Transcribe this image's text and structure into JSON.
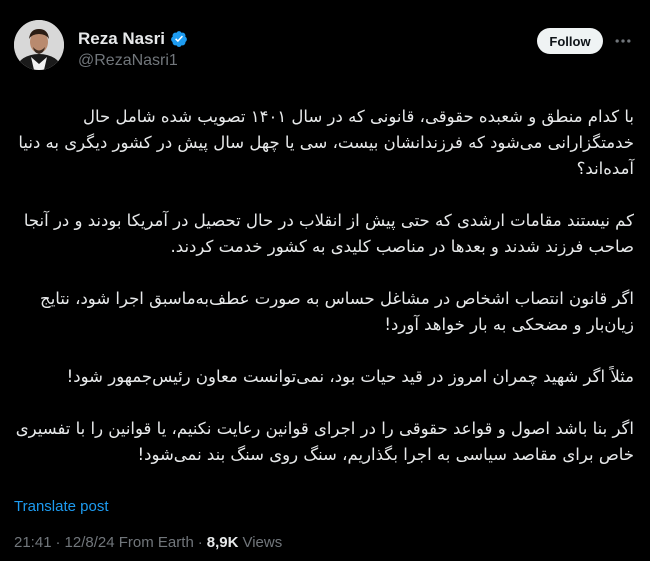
{
  "author": {
    "display_name": "Reza Nasri",
    "handle": "@RezaNasri1",
    "verified": true,
    "verified_color": "#1d9bf0"
  },
  "actions": {
    "follow_label": "Follow",
    "more_icon": "more-horizontal-icon"
  },
  "tweet": {
    "paragraphs": [
      "با کدام منطق و شعبده حقوقی، قانونی که در سال ۱۴۰۱ تصویب شده شامل حال خدمتگزارانی می‌شود که فرزندانشان بیست، سی یا چهل سال پیش در کشور دیگری به دنیا آمده‌اند؟",
      "کم نیستند مقامات ارشدی که حتی پیش از انقلاب در حال تحصیل در آمریکا بودند و در آنجا صاحب فرزند شدند و بعدها در مناصب کلیدی به کشور خدمت کردند.",
      "اگر قانون انتصاب اشخاص در مشاغل حساس به صورت عطف‌به‌ماسبق اجرا شود، نتایج زیان‌بار و مضحکی به بار خواهد آورد!",
      "مثلاً اگر شهید چمران امروز در قید حیات بود، نمی‌توانست معاون رئیس‌جمهور شود!",
      "اگر بنا باشد اصول و قواعد حقوقی را در اجرای قوانین رعایت نکنیم، یا قوانین را با تفسیری خاص برای مقاصد سیاسی به اجرا بگذاریم، سنگ روی سنگ بند نمی‌شود!"
    ],
    "translate_label": "Translate post"
  },
  "meta": {
    "time": "21:41",
    "date": "12/8/24",
    "source": "From Earth",
    "separator": "·",
    "views_count": "8,9K",
    "views_label": "Views"
  },
  "colors": {
    "background": "#000000",
    "text": "#e7e9ea",
    "secondary": "#71767b",
    "link": "#1d9bf0"
  }
}
